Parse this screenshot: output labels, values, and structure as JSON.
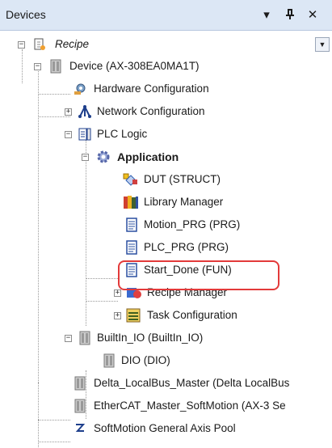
{
  "header": {
    "title": "Devices",
    "dropdown_glyph": "▾",
    "pin_glyph": "ᚆ",
    "close_glyph": "✕"
  },
  "tree": [
    {
      "key": "recipe",
      "label": "Recipe",
      "toggle": "−",
      "icon": "recipe-doc-icon"
    },
    {
      "key": "device",
      "label": "Device (AX-308EA0MA1T)",
      "toggle": "−",
      "icon": "device-icon"
    },
    {
      "key": "hardware",
      "label": "Hardware Configuration",
      "toggle": "",
      "icon": "hardware-config-icon"
    },
    {
      "key": "network",
      "label": "Network Configuration",
      "toggle": "+",
      "icon": "network-config-icon"
    },
    {
      "key": "plclogic",
      "label": "PLC Logic",
      "toggle": "−",
      "icon": "plc-logic-icon"
    },
    {
      "key": "application",
      "label": "Application",
      "toggle": "−",
      "icon": "application-gear-icon"
    },
    {
      "key": "dut",
      "label": "DUT (STRUCT)",
      "toggle": "",
      "icon": "dut-icon"
    },
    {
      "key": "library",
      "label": "Library Manager",
      "toggle": "",
      "icon": "library-books-icon"
    },
    {
      "key": "motion",
      "label": "Motion_PRG (PRG)",
      "toggle": "",
      "icon": "program-doc-icon"
    },
    {
      "key": "plcprg",
      "label": "PLC_PRG (PRG)",
      "toggle": "",
      "icon": "program-doc-icon"
    },
    {
      "key": "startdone",
      "label": "Start_Done (FUN)",
      "toggle": "",
      "icon": "program-doc-icon"
    },
    {
      "key": "recipemgr",
      "label": "Recipe Manager",
      "toggle": "+",
      "icon": "recipe-manager-icon"
    },
    {
      "key": "task",
      "label": "Task Configuration",
      "toggle": "+",
      "icon": "task-config-icon"
    },
    {
      "key": "builtin",
      "label": "BuiltIn_IO (BuiltIn_IO)",
      "toggle": "−",
      "icon": "io-module-icon"
    },
    {
      "key": "dio",
      "label": "DIO (DIO)",
      "toggle": "",
      "icon": "io-module-icon"
    },
    {
      "key": "delta",
      "label": "Delta_LocalBus_Master (Delta LocalBus",
      "toggle": "",
      "icon": "io-module-icon"
    },
    {
      "key": "ethercat",
      "label": "EtherCAT_Master_SoftMotion (AX-3 Se",
      "toggle": "",
      "icon": "io-module-icon"
    },
    {
      "key": "softmotion",
      "label": "SoftMotion General Axis Pool",
      "toggle": "",
      "icon": "axis-pool-icon"
    }
  ],
  "scroll_glyph": "▼",
  "colors": {
    "header_bg": "#dce7f5",
    "highlight": "#e33a3a"
  }
}
